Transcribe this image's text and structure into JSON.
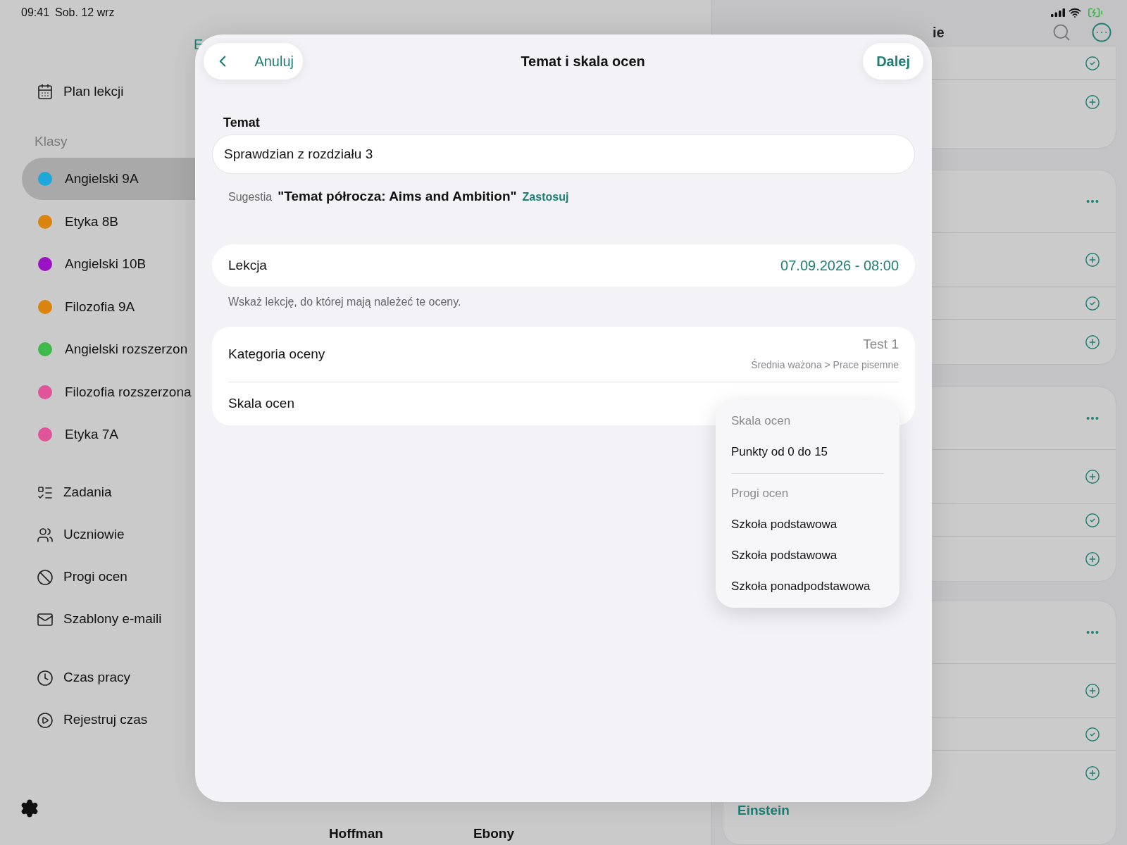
{
  "status_bar": {
    "time": "09:41",
    "date": "Sob. 12 wrz"
  },
  "sidebar": {
    "top_items": [
      {
        "label": "Plan lekcji"
      }
    ],
    "section": "Klasy",
    "classes": [
      {
        "label": "Angielski 9A",
        "color": "#1ea7d8",
        "selected": true
      },
      {
        "label": "Etyka 8B",
        "color": "#d9840f",
        "selected": false
      },
      {
        "label": "Angielski 10B",
        "color": "#9b12c4",
        "selected": false
      },
      {
        "label": "Filozofia 9A",
        "color": "#d9840f",
        "selected": false
      },
      {
        "label": "Angielski rozszerzon",
        "color": "#3fb94a",
        "selected": false
      },
      {
        "label": "Filozofia rozszerzona",
        "color": "#e0559a",
        "selected": false
      },
      {
        "label": "Etyka 7A",
        "color": "#e0559a",
        "selected": false
      }
    ],
    "tools": [
      {
        "label": "Zadania"
      },
      {
        "label": "Uczniowie"
      },
      {
        "label": "Progi ocen"
      },
      {
        "label": "Szablony e-maili"
      }
    ],
    "time": [
      {
        "label": "Czas pracy"
      },
      {
        "label": "Rejestruj czas"
      }
    ]
  },
  "background": {
    "left_header_fragment": "E",
    "right_header_fragment": "ie",
    "names": [
      "Hoffman",
      "Ebony"
    ],
    "cards": [
      {
        "rows": [
          {
            "kind": "check"
          },
          {
            "kind": "add"
          }
        ]
      },
      {
        "rows": [
          {
            "kind": "more"
          },
          {
            "kind": "add"
          },
          {
            "kind": "check"
          },
          {
            "kind": "add"
          }
        ]
      },
      {
        "rows": [
          {
            "kind": "more"
          },
          {
            "kind": "add"
          },
          {
            "kind": "check"
          },
          {
            "kind": "add"
          }
        ]
      },
      {
        "rows": [
          {
            "kind": "more"
          },
          {
            "kind": "add"
          },
          {
            "kind": "check"
          },
          {
            "kind": "add"
          }
        ],
        "footer": "Einstein"
      }
    ]
  },
  "modal": {
    "back_label": "Anuluj",
    "title": "Temat i skala ocen",
    "next_label": "Dalej",
    "topic": {
      "label": "Temat",
      "value": "Sprawdzian z rozdziału 3"
    },
    "suggestion": {
      "label": "Sugestia",
      "text": "\"Temat półrocza: Aims and Ambition\"",
      "action": "Zastosuj"
    },
    "lesson": {
      "label": "Lekcja",
      "value": "07.09.2026 - 08:00",
      "hint": "Wskaż lekcję, do której mają należeć te oceny."
    },
    "category": {
      "label": "Kategoria oceny",
      "value": "Test 1",
      "path": "Średnia ważona > Prace pisemne"
    },
    "scale": {
      "label": "Skala ocen"
    },
    "menu": {
      "sections": [
        {
          "header": "Skala ocen",
          "items": [
            "Punkty od 0 do 15"
          ]
        },
        {
          "header": "Progi ocen",
          "items": [
            "Szkoła podstawowa",
            "Szkoła podstawowa",
            "Szkoła ponadpodstawowa"
          ]
        }
      ]
    }
  }
}
